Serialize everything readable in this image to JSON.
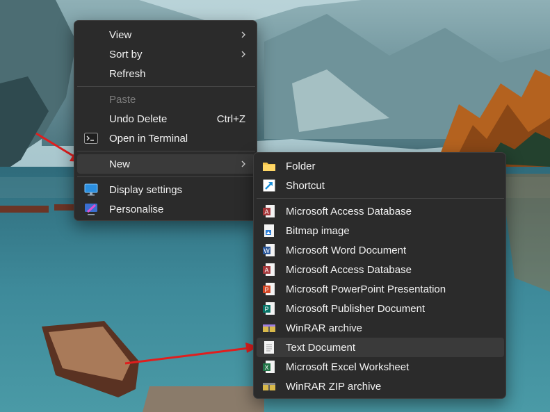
{
  "colors": {
    "menu_bg": "#2b2b2b",
    "menu_text": "#f2f2f2",
    "disabled_text": "#7d7d7d",
    "highlight_bg": "#3a3a3a",
    "annotation_arrow": "#e01e1e"
  },
  "context_menu": {
    "items": [
      {
        "label": "View",
        "icon": null,
        "submenu": true
      },
      {
        "label": "Sort by",
        "icon": null,
        "submenu": true
      },
      {
        "label": "Refresh",
        "icon": null
      },
      {
        "label": "Paste",
        "icon": null,
        "disabled": true
      },
      {
        "label": "Undo Delete",
        "shortcut": "Ctrl+Z",
        "icon": null
      },
      {
        "label": "Open in Terminal",
        "icon": "terminal-icon"
      },
      {
        "label": "New",
        "icon": null,
        "submenu": true,
        "highlighted": true
      },
      {
        "label": "Display settings",
        "icon": "monitor-icon"
      },
      {
        "label": "Personalise",
        "icon": "personalise-icon"
      }
    ]
  },
  "new_submenu": {
    "items": [
      {
        "label": "Folder",
        "icon": "folder-icon"
      },
      {
        "label": "Shortcut",
        "icon": "shortcut-icon"
      },
      {
        "label": "Microsoft Access Database",
        "icon": "access-icon"
      },
      {
        "label": "Bitmap image",
        "icon": "bitmap-icon"
      },
      {
        "label": "Microsoft Word Document",
        "icon": "word-icon"
      },
      {
        "label": "Microsoft Access Database",
        "icon": "access-icon"
      },
      {
        "label": "Microsoft PowerPoint Presentation",
        "icon": "powerpoint-icon"
      },
      {
        "label": "Microsoft Publisher Document",
        "icon": "publisher-icon"
      },
      {
        "label": "WinRAR archive",
        "icon": "winrar-icon"
      },
      {
        "label": "Text Document",
        "icon": "text-document-icon",
        "highlighted": true
      },
      {
        "label": "Microsoft Excel Worksheet",
        "icon": "excel-icon"
      },
      {
        "label": "WinRAR ZIP archive",
        "icon": "winrar-zip-icon"
      }
    ]
  }
}
